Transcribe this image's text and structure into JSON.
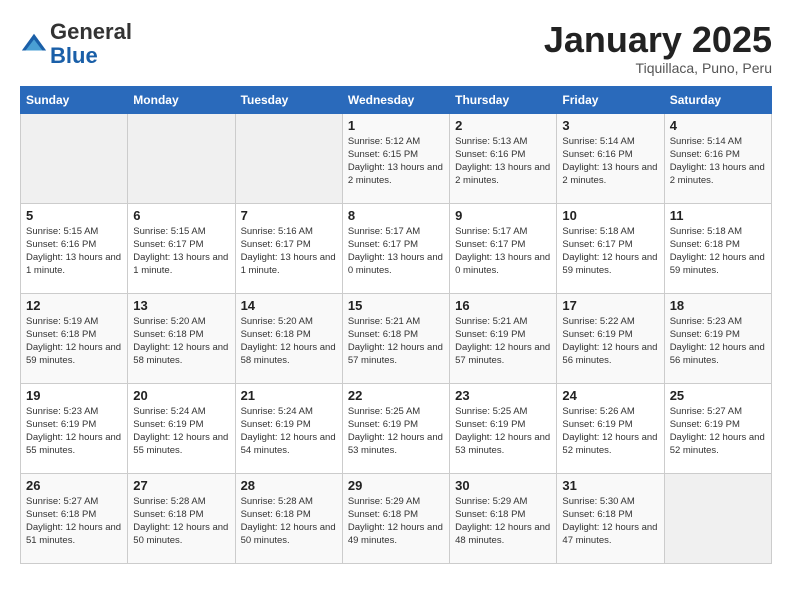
{
  "header": {
    "logo_general": "General",
    "logo_blue": "Blue",
    "month_title": "January 2025",
    "subtitle": "Tiquillaca, Puno, Peru"
  },
  "days_of_week": [
    "Sunday",
    "Monday",
    "Tuesday",
    "Wednesday",
    "Thursday",
    "Friday",
    "Saturday"
  ],
  "weeks": [
    [
      {
        "day": "",
        "empty": true
      },
      {
        "day": "",
        "empty": true
      },
      {
        "day": "",
        "empty": true
      },
      {
        "day": "1",
        "sunrise": "5:12 AM",
        "sunset": "6:15 PM",
        "daylight": "13 hours and 2 minutes."
      },
      {
        "day": "2",
        "sunrise": "5:13 AM",
        "sunset": "6:16 PM",
        "daylight": "13 hours and 2 minutes."
      },
      {
        "day": "3",
        "sunrise": "5:14 AM",
        "sunset": "6:16 PM",
        "daylight": "13 hours and 2 minutes."
      },
      {
        "day": "4",
        "sunrise": "5:14 AM",
        "sunset": "6:16 PM",
        "daylight": "13 hours and 2 minutes."
      }
    ],
    [
      {
        "day": "5",
        "sunrise": "5:15 AM",
        "sunset": "6:16 PM",
        "daylight": "13 hours and 1 minute."
      },
      {
        "day": "6",
        "sunrise": "5:15 AM",
        "sunset": "6:17 PM",
        "daylight": "13 hours and 1 minute."
      },
      {
        "day": "7",
        "sunrise": "5:16 AM",
        "sunset": "6:17 PM",
        "daylight": "13 hours and 1 minute."
      },
      {
        "day": "8",
        "sunrise": "5:17 AM",
        "sunset": "6:17 PM",
        "daylight": "13 hours and 0 minutes."
      },
      {
        "day": "9",
        "sunrise": "5:17 AM",
        "sunset": "6:17 PM",
        "daylight": "13 hours and 0 minutes."
      },
      {
        "day": "10",
        "sunrise": "5:18 AM",
        "sunset": "6:17 PM",
        "daylight": "12 hours and 59 minutes."
      },
      {
        "day": "11",
        "sunrise": "5:18 AM",
        "sunset": "6:18 PM",
        "daylight": "12 hours and 59 minutes."
      }
    ],
    [
      {
        "day": "12",
        "sunrise": "5:19 AM",
        "sunset": "6:18 PM",
        "daylight": "12 hours and 59 minutes."
      },
      {
        "day": "13",
        "sunrise": "5:20 AM",
        "sunset": "6:18 PM",
        "daylight": "12 hours and 58 minutes."
      },
      {
        "day": "14",
        "sunrise": "5:20 AM",
        "sunset": "6:18 PM",
        "daylight": "12 hours and 58 minutes."
      },
      {
        "day": "15",
        "sunrise": "5:21 AM",
        "sunset": "6:18 PM",
        "daylight": "12 hours and 57 minutes."
      },
      {
        "day": "16",
        "sunrise": "5:21 AM",
        "sunset": "6:19 PM",
        "daylight": "12 hours and 57 minutes."
      },
      {
        "day": "17",
        "sunrise": "5:22 AM",
        "sunset": "6:19 PM",
        "daylight": "12 hours and 56 minutes."
      },
      {
        "day": "18",
        "sunrise": "5:23 AM",
        "sunset": "6:19 PM",
        "daylight": "12 hours and 56 minutes."
      }
    ],
    [
      {
        "day": "19",
        "sunrise": "5:23 AM",
        "sunset": "6:19 PM",
        "daylight": "12 hours and 55 minutes."
      },
      {
        "day": "20",
        "sunrise": "5:24 AM",
        "sunset": "6:19 PM",
        "daylight": "12 hours and 55 minutes."
      },
      {
        "day": "21",
        "sunrise": "5:24 AM",
        "sunset": "6:19 PM",
        "daylight": "12 hours and 54 minutes."
      },
      {
        "day": "22",
        "sunrise": "5:25 AM",
        "sunset": "6:19 PM",
        "daylight": "12 hours and 53 minutes."
      },
      {
        "day": "23",
        "sunrise": "5:25 AM",
        "sunset": "6:19 PM",
        "daylight": "12 hours and 53 minutes."
      },
      {
        "day": "24",
        "sunrise": "5:26 AM",
        "sunset": "6:19 PM",
        "daylight": "12 hours and 52 minutes."
      },
      {
        "day": "25",
        "sunrise": "5:27 AM",
        "sunset": "6:19 PM",
        "daylight": "12 hours and 52 minutes."
      }
    ],
    [
      {
        "day": "26",
        "sunrise": "5:27 AM",
        "sunset": "6:18 PM",
        "daylight": "12 hours and 51 minutes."
      },
      {
        "day": "27",
        "sunrise": "5:28 AM",
        "sunset": "6:18 PM",
        "daylight": "12 hours and 50 minutes."
      },
      {
        "day": "28",
        "sunrise": "5:28 AM",
        "sunset": "6:18 PM",
        "daylight": "12 hours and 50 minutes."
      },
      {
        "day": "29",
        "sunrise": "5:29 AM",
        "sunset": "6:18 PM",
        "daylight": "12 hours and 49 minutes."
      },
      {
        "day": "30",
        "sunrise": "5:29 AM",
        "sunset": "6:18 PM",
        "daylight": "12 hours and 48 minutes."
      },
      {
        "day": "31",
        "sunrise": "5:30 AM",
        "sunset": "6:18 PM",
        "daylight": "12 hours and 47 minutes."
      },
      {
        "day": "",
        "empty": true
      }
    ]
  ]
}
